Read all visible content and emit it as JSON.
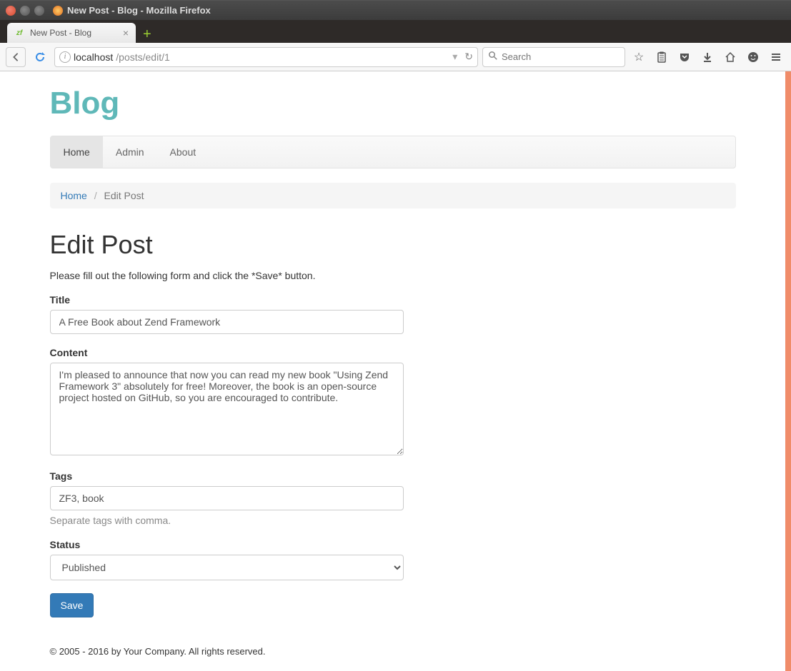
{
  "window": {
    "title": "New Post - Blog - Mozilla Firefox",
    "tab_title": "New Post - Blog"
  },
  "toolbar": {
    "url_host": "localhost",
    "url_path": "/posts/edit/1",
    "search_placeholder": "Search"
  },
  "page": {
    "brand": "Blog",
    "nav": {
      "home": "Home",
      "admin": "Admin",
      "about": "About"
    },
    "breadcrumb": {
      "home": "Home",
      "current": "Edit Post"
    },
    "heading": "Edit Post",
    "instruction": "Please fill out the following form and click the *Save* button.",
    "form": {
      "title_label": "Title",
      "title_value": "A Free Book about Zend Framework",
      "content_label": "Content",
      "content_value": "I'm pleased to announce that now you can read my new book \"Using Zend Framework 3\" absolutely for free! Moreover, the book is an open-source project hosted on GitHub, so you are encouraged to contribute.",
      "tags_label": "Tags",
      "tags_value": "ZF3, book",
      "tags_help": "Separate tags with comma.",
      "status_label": "Status",
      "status_value": "Published",
      "save_label": "Save"
    },
    "footer": "© 2005 - 2016 by Your Company. All rights reserved."
  }
}
